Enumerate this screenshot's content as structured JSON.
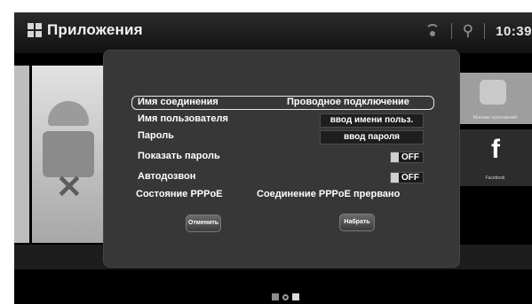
{
  "header": {
    "title": "Приложения",
    "clock": "10:39"
  },
  "icons": {
    "apps": "grid-icon",
    "wifi": "wifi-icon",
    "usb": "usb-icon"
  },
  "background": {
    "right_card_caption": "Магазин приложений",
    "fb_card_letter": "f",
    "fb_card_caption": "Facebook"
  },
  "dialog": {
    "connection_name_label": "Имя соединения",
    "connection_name_value": "Проводное подключение",
    "username_label": "Имя пользователя",
    "username_placeholder": "ввод имени польз.",
    "password_label": "Пароль",
    "password_placeholder": "ввод пароля",
    "show_password_label": "Показать пароль",
    "show_password_state": "OFF",
    "autodial_label": "Автодозвон",
    "autodial_state": "OFF",
    "pppoe_status_label": "Состояние PPPoE",
    "pppoe_status_value": "Соединение PPPoE прервано",
    "cancel_label": "Отменить",
    "dial_label": "Набрать"
  },
  "colors": {
    "dialog_bg": "#373737",
    "screen_bg": "#000000"
  }
}
